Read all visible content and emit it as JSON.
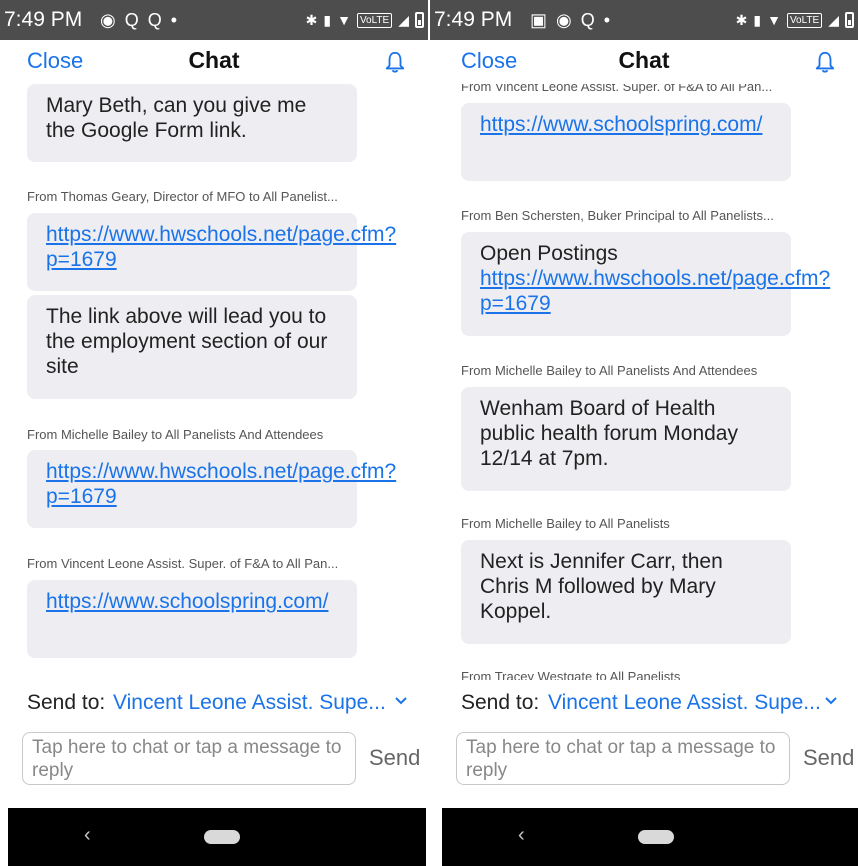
{
  "left": {
    "status": {
      "time": "7:49 PM",
      "icons_left": [
        "facebook-icon",
        "search-icon",
        "search-icon",
        "dot-icon"
      ]
    },
    "header": {
      "close": "Close",
      "title": "Chat"
    },
    "messages": [
      {
        "type": "bubble",
        "text": "Mary Beth, can you give me the Google Form link."
      },
      {
        "type": "sender",
        "text": "From Thomas Geary, Director of MFO to All Panelist..."
      },
      {
        "type": "link",
        "text": "https://www.hwschools.net/page.cfm?p=1679"
      },
      {
        "type": "bubble",
        "text": "The link above will lead you to the employment section of our site"
      },
      {
        "type": "sender",
        "text": "From Michelle Bailey to All Panelists And Attendees"
      },
      {
        "type": "link",
        "text": "https://www.hwschools.net/page.cfm?p=1679"
      },
      {
        "type": "sender",
        "text": "From Vincent Leone Assist. Super. of F&A to All Pan..."
      },
      {
        "type": "link",
        "text": "https://www.schoolspring.com/"
      }
    ],
    "sendto": {
      "label": "Send to:",
      "value": "Vincent Leone Assist. Supe..."
    },
    "input": {
      "placeholder": "Tap here to chat or tap a message to reply"
    },
    "send": "Send"
  },
  "right": {
    "status": {
      "time": "7:49 PM",
      "icons_left": [
        "image-icon",
        "facebook-icon",
        "search-icon",
        "dot-icon"
      ]
    },
    "header": {
      "close": "Close",
      "title": "Chat"
    },
    "messages": [
      {
        "type": "sender",
        "text": "From Vincent Leone Assist. Super. of F&A to All Pan..."
      },
      {
        "type": "link",
        "text": "https://www.schoolspring.com/"
      },
      {
        "type": "sender",
        "text": "From Ben Schersten, Buker Principal to All Panelists..."
      },
      {
        "type": "mixed",
        "text": "Open Postings ",
        "link": "https://www.hwschools.net/page.cfm?p=1679"
      },
      {
        "type": "sender",
        "text": "From Michelle Bailey to All Panelists And Attendees"
      },
      {
        "type": "bubble",
        "text": "Wenham Board of Health public health forum Monday 12/14 at 7pm."
      },
      {
        "type": "sender",
        "text": "From Michelle Bailey to All Panelists"
      },
      {
        "type": "bubble",
        "text": "Next is Jennifer Carr, then Chris M followed by Mary Koppel."
      },
      {
        "type": "sender",
        "text": "From Tracey Westgate to All Panelists"
      }
    ],
    "sendto": {
      "label": "Send to:",
      "value": "Vincent Leone Assist. Supe..."
    },
    "input": {
      "placeholder": "Tap here to chat or tap a message to reply"
    },
    "send": "Send"
  },
  "colors": {
    "accent": "#1a73e8",
    "statusbar": "#4d4d4d",
    "bubble": "#eeeef2",
    "navbar": "#000000"
  }
}
